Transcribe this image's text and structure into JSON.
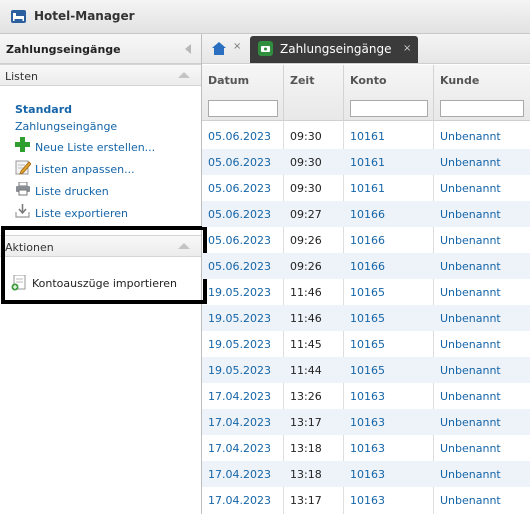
{
  "app": {
    "title": "Hotel-Manager"
  },
  "sidebar": {
    "title": "Zahlungseingänge",
    "listen": {
      "header": "Listen",
      "standard_label": "Standard",
      "current_list": "Zahlungseingänge",
      "actions": [
        {
          "label": "Neue Liste erstellen...",
          "icon": "plus-icon"
        },
        {
          "label": "Listen anpassen...",
          "icon": "edit-icon"
        },
        {
          "label": "Liste drucken",
          "icon": "printer-icon"
        },
        {
          "label": "Liste exportieren",
          "icon": "export-icon"
        }
      ]
    },
    "aktionen": {
      "header": "Aktionen",
      "items": [
        {
          "label": "Kontoauszüge importieren",
          "icon": "import-icon"
        }
      ]
    }
  },
  "tabs": {
    "home_close": "×",
    "active": {
      "label": "Zahlungseingänge",
      "close": "×"
    }
  },
  "table": {
    "columns": [
      "Datum",
      "Zeit",
      "Konto",
      "Kunde"
    ],
    "rows": [
      [
        "05.06.2023",
        "09:30",
        "10161",
        "Unbenannt"
      ],
      [
        "05.06.2023",
        "09:30",
        "10161",
        "Unbenannt"
      ],
      [
        "05.06.2023",
        "09:30",
        "10161",
        "Unbenannt"
      ],
      [
        "05.06.2023",
        "09:27",
        "10166",
        "Unbenannt"
      ],
      [
        "05.06.2023",
        "09:26",
        "10166",
        "Unbenannt"
      ],
      [
        "05.06.2023",
        "09:26",
        "10166",
        "Unbenannt"
      ],
      [
        "19.05.2023",
        "11:46",
        "10165",
        "Unbenannt"
      ],
      [
        "19.05.2023",
        "11:46",
        "10165",
        "Unbenannt"
      ],
      [
        "19.05.2023",
        "11:45",
        "10165",
        "Unbenannt"
      ],
      [
        "19.05.2023",
        "11:44",
        "10165",
        "Unbenannt"
      ],
      [
        "17.04.2023",
        "13:26",
        "10163",
        "Unbenannt"
      ],
      [
        "17.04.2023",
        "13:17",
        "10163",
        "Unbenannt"
      ],
      [
        "17.04.2023",
        "13:18",
        "10163",
        "Unbenannt"
      ],
      [
        "17.04.2023",
        "13:18",
        "10163",
        "Unbenannt"
      ],
      [
        "17.04.2023",
        "13:17",
        "10163",
        "Unbenannt"
      ]
    ]
  },
  "colors": {
    "link": "#1565a8",
    "tab_active_bg": "#3b3b3b",
    "row_alt": "#eef3f9",
    "highlight_border": "#000000"
  }
}
